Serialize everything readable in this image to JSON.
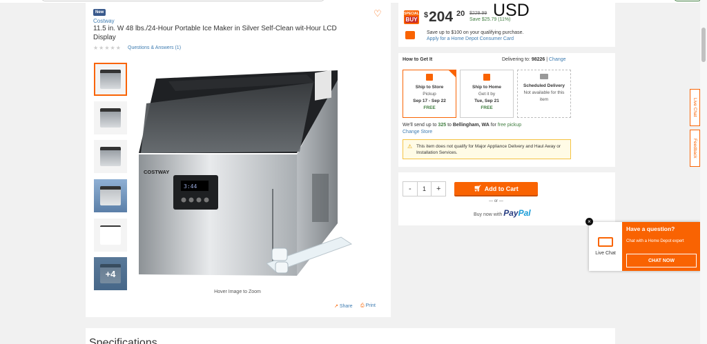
{
  "product": {
    "badge": "New",
    "brand": "Costway",
    "title": "11.5 in. W 48 lbs./24-Hour Portable Ice Maker in Silver Self-Clean wit-Hour LCD Display",
    "rating_stars": "★★★★★",
    "qa_link": "Questions & Answers (1)",
    "thumbnails_more": "+4",
    "hover_zoom": "Hover Image to Zoom",
    "share": "Share",
    "print": "Print",
    "brand_on_image": "COSTWAY"
  },
  "price": {
    "special_buy_top": "SPECIAL",
    "special_buy_bottom": "BUY",
    "dollar_sign": "$",
    "main": "204",
    "cents": "20",
    "was": "$229.99",
    "save": "Save $25.79 (11%)",
    "overlay_currency": "USD",
    "card_offer": "Save up to $100 on your qualifying purchase.",
    "card_link": "Apply for a Home Depot Consumer Card"
  },
  "how_to_get_it": {
    "heading": "How to Get It",
    "delivering_to_label": "Delivering to:",
    "zip": "98226",
    "change": "Change",
    "options": [
      {
        "title": "Ship to Store",
        "line1": "Pickup",
        "line2": "Sep 17 - Sep 22",
        "line3": "FREE"
      },
      {
        "title": "Ship to Home",
        "line1": "Get it by",
        "line2": "Tue, Sep 21",
        "line3": "FREE"
      },
      {
        "title": "Scheduled Delivery",
        "line1": "Not available for this",
        "line2": "item",
        "line3": ""
      }
    ],
    "send_prefix": "We'll send up to",
    "send_qty": "325",
    "send_mid": "to",
    "send_store": "Bellingham, WA",
    "send_suffix": "for",
    "send_free": "free pickup",
    "change_store": "Change Store",
    "warning": "This item does not qualify for Major Appliance Delivery and Haul Away or Installation Services."
  },
  "cart": {
    "minus": "-",
    "quantity": "1",
    "plus": "+",
    "add_to_cart": "Add to Cart",
    "or": "— or —",
    "buy_now_with": "Buy now with",
    "paypal_pay": "Pay",
    "paypal_pal": "Pal"
  },
  "specifications": {
    "title": "Specifications"
  },
  "chat_popup": {
    "close": "×",
    "live_chat": "Live Chat",
    "question": "Have a question?",
    "subtitle": "Chat with a Home Depot expert",
    "button": "CHAT NOW"
  },
  "side_tabs": {
    "live_chat": "Live Chat",
    "feedback": "Feedback"
  },
  "icons": [
    "heart-icon",
    "cart-icon",
    "share-icon",
    "print-icon",
    "warning-icon",
    "chat-icon",
    "box-icon",
    "truck-icon",
    "credit-card-icon"
  ],
  "colors": {
    "accent": "#f96302",
    "link": "#3e7cb1",
    "success": "#3e7c3e",
    "paypal_dark": "#253b80",
    "paypal_light": "#179bd7"
  }
}
